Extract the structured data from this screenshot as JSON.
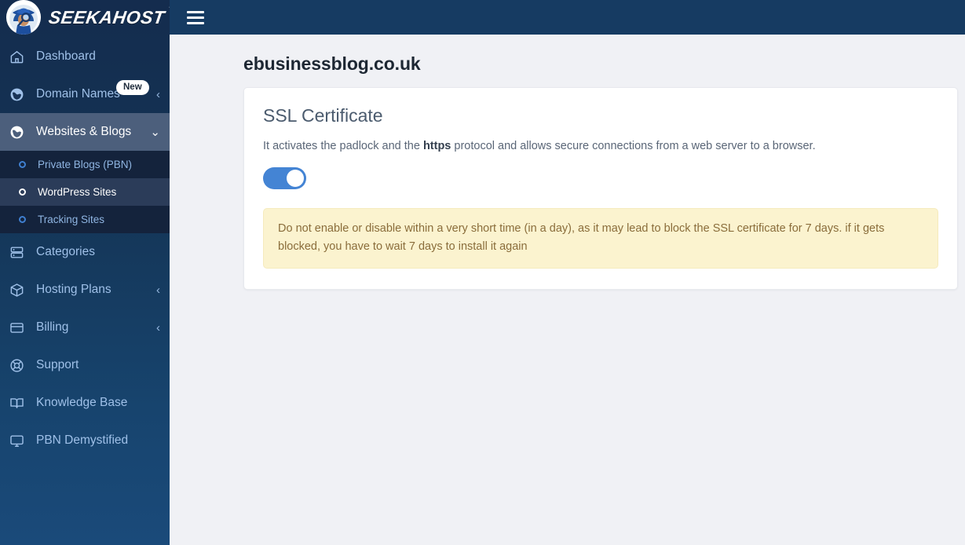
{
  "brand": {
    "name": "SEEKAHOST",
    "tm": "™",
    "logo_icon": "detective-avatar-icon"
  },
  "topbar": {
    "menu_toggle_label": "menu-toggle"
  },
  "sidebar": {
    "items": [
      {
        "label": "Dashboard",
        "icon": "home-icon",
        "arrow": "",
        "badge": "",
        "active": false
      },
      {
        "label": "Domain Names",
        "icon": "globe-icon",
        "arrow": "‹",
        "badge": "New",
        "active": false
      },
      {
        "label": "Websites & Blogs",
        "icon": "globe-icon",
        "arrow": "⌄",
        "badge": "",
        "active": true
      },
      {
        "label": "Categories",
        "icon": "server-icon",
        "arrow": "",
        "badge": "",
        "active": false
      },
      {
        "label": "Hosting Plans",
        "icon": "box-icon",
        "arrow": "‹",
        "badge": "",
        "active": false
      },
      {
        "label": "Billing",
        "icon": "credit-card-icon",
        "arrow": "‹",
        "badge": "",
        "active": false
      },
      {
        "label": "Support",
        "icon": "life-ring-icon",
        "arrow": "",
        "badge": "",
        "active": false
      },
      {
        "label": "Knowledge Base",
        "icon": "book-icon",
        "arrow": "",
        "badge": "",
        "active": false
      },
      {
        "label": "PBN Demystified",
        "icon": "monitor-icon",
        "arrow": "",
        "badge": "",
        "active": false
      }
    ],
    "submenu": [
      {
        "label": "Private Blogs (PBN)",
        "icon": "circle-icon",
        "active": false
      },
      {
        "label": "WordPress Sites",
        "icon": "circle-icon",
        "active": true
      },
      {
        "label": "Tracking Sites",
        "icon": "circle-icon",
        "active": false
      }
    ]
  },
  "main": {
    "page_title": "ebusinessblog.co.uk",
    "card": {
      "title": "SSL Certificate",
      "description_before": "It activates the padlock and the ",
      "description_bold": "https",
      "description_after": " protocol and allows secure connections from a web server to a browser.",
      "toggle_state": "on",
      "alert_text": "Do not enable or disable within a very short time (in a day), as it may lead to block the SSL certificate for 7 days. if it gets blocked, you have to wait 7 days to install it again"
    }
  },
  "colors": {
    "sidebar_top": "#142c4e",
    "sidebar_bottom": "#1a4a7a",
    "topbar": "#163b62",
    "accent_blue": "#4484d4",
    "alert_bg": "#fbf3cf",
    "alert_text": "#8a6d3b",
    "content_bg": "#f0f1f5"
  }
}
